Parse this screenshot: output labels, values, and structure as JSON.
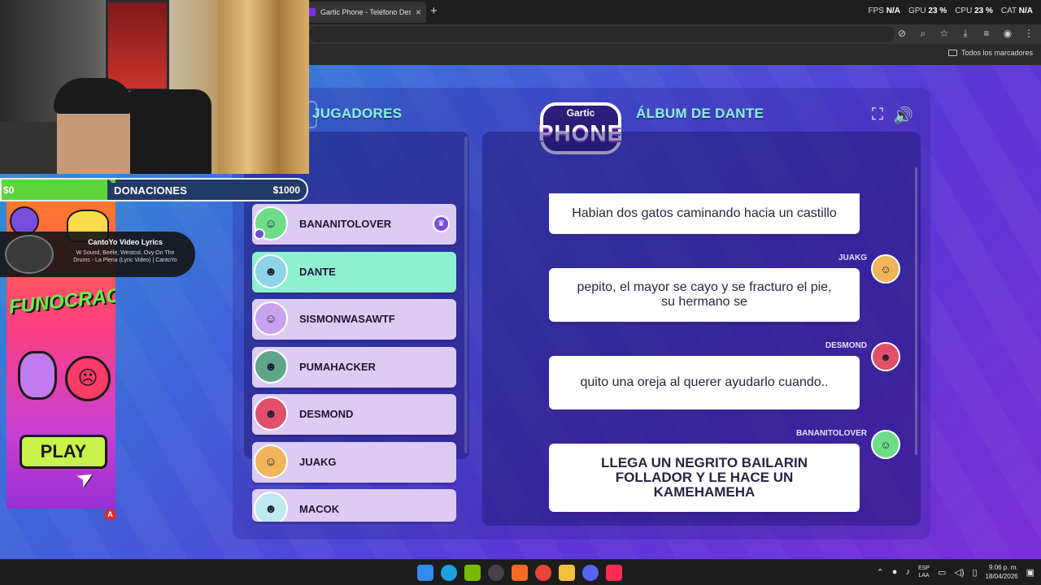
{
  "browser": {
    "tab_title": "Gartic Phone - Teléfono Descon",
    "tab_close": "×",
    "new_tab": "+",
    "perf": [
      {
        "label": "FPS",
        "value": "N/A"
      },
      {
        "label": "GPU",
        "value": "23 %"
      },
      {
        "label": "CPU",
        "value": "23 %"
      },
      {
        "label": "CAT",
        "value": "N/A"
      }
    ],
    "bookmarks_label": "Todos los marcadores"
  },
  "game": {
    "logo_top": "Gartic",
    "logo_bottom": "PHONE",
    "players_heading": "JUGADORES",
    "album_heading": "ÁLBUM DE DANTE",
    "players": [
      {
        "name": "BANANITOLOVER",
        "avatar_color": "#6fdc8a",
        "avatar_glyph": "☺",
        "host": true,
        "active": false
      },
      {
        "name": "DANTE",
        "avatar_color": "#8fd3e8",
        "avatar_glyph": "☻",
        "host": false,
        "active": true
      },
      {
        "name": "SISMONWASAWTF",
        "avatar_color": "#c9a2ef",
        "avatar_glyph": "☺",
        "host": false,
        "active": false
      },
      {
        "name": "PUMAHACKER",
        "avatar_color": "#5fa58a",
        "avatar_glyph": "☻",
        "host": false,
        "active": false
      },
      {
        "name": "DESMOND",
        "avatar_color": "#e0506a",
        "avatar_glyph": "☻",
        "host": false,
        "active": false
      },
      {
        "name": "JUAKG",
        "avatar_color": "#f0b45a",
        "avatar_glyph": "☺",
        "host": false,
        "active": false
      },
      {
        "name": "MACOK",
        "avatar_color": "#bfe9f0",
        "avatar_glyph": "☻",
        "host": false,
        "active": false
      }
    ],
    "album": [
      {
        "author": "",
        "text": "Habian dos gatos caminando hacia un castillo"
      },
      {
        "author": "JUAKG",
        "text": "pepito, el mayor se cayo y se fracturo el pie, su hermano se"
      },
      {
        "author": "DESMOND",
        "text": "quito una oreja al querer ayudarlo cuando.."
      },
      {
        "author": "BANANITOLOVER",
        "text": "LLEGA UN NEGRITO BAILARIN FOLLADOR Y LE HACE UN KAMEHAMEHA"
      }
    ],
    "colors": {
      "accent_heading": "#8bf2d8",
      "active_player": "#8ff0cf",
      "player_bg": "#dccbf3"
    }
  },
  "overlay": {
    "donations": {
      "min": "$0",
      "label": "DONACIONES",
      "max": "$1000"
    },
    "music": {
      "title": "CantoYo Video Lyrics",
      "subtitle": "W Sound, Beéle, Westcol, Ovy On The Drums - La Plena (Lyric Video) | CantoYo"
    },
    "ad": {
      "brand": "FUNOCRACY",
      "play_label": "PLAY",
      "badge": "A"
    }
  },
  "taskbar": {
    "lang_top": "ESP",
    "lang_bottom": "LAA",
    "time": "9:06 p. m.",
    "date": "18/04/2026"
  }
}
